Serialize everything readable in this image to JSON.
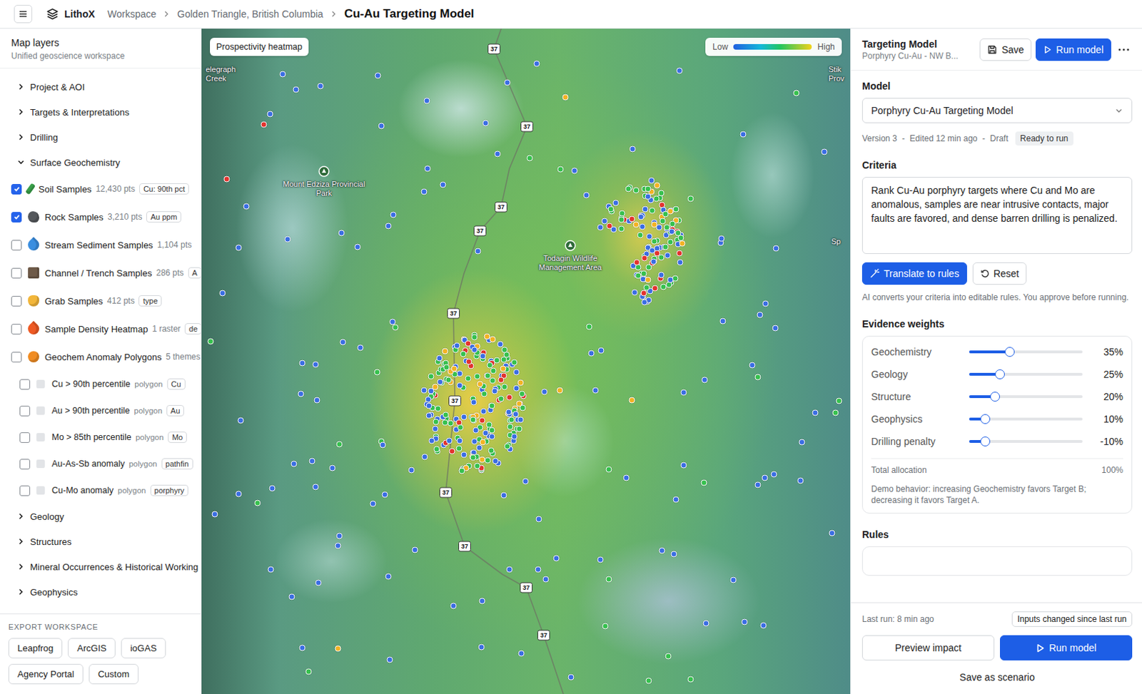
{
  "topbar": {
    "app": "LithoX",
    "breadcrumbs": [
      {
        "label": "Workspace",
        "current": false
      },
      {
        "label": "Golden Triangle, British Columbia",
        "current": false
      },
      {
        "label": "Cu-Au Targeting Model",
        "current": true
      }
    ]
  },
  "layers_panel": {
    "title": "Map layers",
    "subtitle": "Unified geoscience workspace",
    "items": [
      {
        "kind": "group",
        "label": "Project & AOI",
        "expanded": false
      },
      {
        "kind": "group",
        "label": "Targets & Interpretations",
        "expanded": false
      },
      {
        "kind": "group",
        "label": "Drilling",
        "expanded": false
      },
      {
        "kind": "group",
        "label": "Surface Geochemistry",
        "expanded": true
      },
      {
        "kind": "layer",
        "label": "Soil Samples",
        "meta": "12,430 pts",
        "tag": "Cu: 90th pct",
        "checked": true
      },
      {
        "kind": "layer",
        "label": "Rock Samples",
        "meta": "3,210 pts",
        "tag": "Au ppm",
        "checked": true
      },
      {
        "kind": "layer",
        "label": "Stream Sediment Samples",
        "meta": "1,104 pts",
        "checked": false
      },
      {
        "kind": "layer",
        "label": "Channel / Trench Samples",
        "meta": "286 pts",
        "tag": "A",
        "checked": false
      },
      {
        "kind": "layer",
        "label": "Grab Samples",
        "meta": "412 pts",
        "tag": "type",
        "checked": false
      },
      {
        "kind": "layer",
        "label": "Sample Density Heatmap",
        "meta": "1 raster",
        "tag": "de",
        "checked": false
      },
      {
        "kind": "layer",
        "label": "Geochem Anomaly Polygons",
        "meta": "5 themes",
        "checked": false
      },
      {
        "kind": "sublayer",
        "label": "Cu > 90th percentile",
        "meta": "polygon",
        "tag": "Cu",
        "checked": false
      },
      {
        "kind": "sublayer",
        "label": "Au > 90th percentile",
        "meta": "polygon",
        "tag": "Au",
        "checked": false
      },
      {
        "kind": "sublayer",
        "label": "Mo > 85th percentile",
        "meta": "polygon",
        "tag": "Mo",
        "checked": false
      },
      {
        "kind": "sublayer",
        "label": "Au-As-Sb anomaly",
        "meta": "polygon",
        "tag": "pathfin",
        "checked": false
      },
      {
        "kind": "sublayer",
        "label": "Cu-Mo anomaly",
        "meta": "polygon",
        "tag": "porphyry",
        "checked": false
      },
      {
        "kind": "group",
        "label": "Geology",
        "expanded": false
      },
      {
        "kind": "group",
        "label": "Structures",
        "expanded": false
      },
      {
        "kind": "group",
        "label": "Mineral Occurrences & Historical Working",
        "expanded": false
      },
      {
        "kind": "group",
        "label": "Geophysics",
        "expanded": false
      }
    ]
  },
  "export": {
    "title": "EXPORT WORKSPACE",
    "buttons": [
      "Leapfrog",
      "ArcGIS",
      "ioGAS",
      "Agency Portal",
      "Custom"
    ]
  },
  "map": {
    "chip": "Prospectivity heatmap",
    "legend": {
      "low": "Low",
      "high": "High"
    },
    "places": [
      {
        "kind": "town",
        "label": "elegraph Creek"
      },
      {
        "kind": "park",
        "label": "Mount Edziza Provincial Park"
      },
      {
        "kind": "park",
        "label": "Todagin Wildlife Management Area"
      },
      {
        "kind": "town",
        "label": "Stik Prov"
      },
      {
        "kind": "town",
        "label": "Sp"
      }
    ],
    "road_shields": [
      "37",
      "37",
      "37",
      "37",
      "37",
      "37",
      "37",
      "37",
      "37",
      "37"
    ],
    "sample_colors": [
      "#3b6ee3",
      "#37c14e",
      "#f3b324",
      "#e3342f"
    ]
  },
  "model_panel": {
    "title": "Targeting Model",
    "subtitle": "Porphyry Cu-Au - NW B...",
    "save": "Save",
    "run": "Run model",
    "model_label": "Model",
    "model_select": "Porphyry Cu-Au Targeting Model",
    "meta": [
      "Version 3",
      "Edited 12 min ago",
      "Draft"
    ],
    "meta_separator": "-",
    "status": "Ready to run",
    "criteria_label": "Criteria",
    "criteria": "Rank Cu-Au porphyry targets where Cu and Mo are anomalous, samples are near intrusive contacts, major faults are favored, and dense barren drilling is penalized.",
    "translate": "Translate to rules",
    "reset": "Reset",
    "helper": "AI converts your criteria into editable rules. You approve before running.",
    "weights_label": "Evidence weights",
    "weights": [
      {
        "label": "Geochemistry",
        "value": "35%",
        "level": 0.36
      },
      {
        "label": "Geology",
        "value": "25%",
        "level": 0.27
      },
      {
        "label": "Structure",
        "value": "20%",
        "level": 0.23
      },
      {
        "label": "Geophysics",
        "value": "10%",
        "level": 0.14
      },
      {
        "label": "Drilling penalty",
        "value": "-10%",
        "level": 0.14
      }
    ],
    "total_label": "Total allocation",
    "total": "100%",
    "note": "Demo behavior: increasing Geochemistry favors Target B; decreasing it favors Target A.",
    "rules_label": "Rules"
  },
  "footer": {
    "last_run": "Last run: 8 min ago",
    "changed": "Inputs changed since last run",
    "preview": "Preview impact",
    "run": "Run model",
    "save_scenario": "Save as scenario"
  }
}
